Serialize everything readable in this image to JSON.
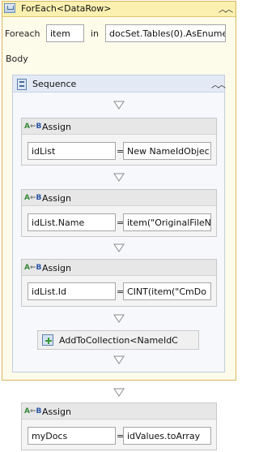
{
  "foreach": {
    "title": "ForEach<DataRow>",
    "foreach_label": "Foreach",
    "item_value": "item",
    "in_label": "in",
    "collection_value": "docSet.Tables(0).AsEnume",
    "body_label": "Body",
    "collapse_icon": "double-chevron-up"
  },
  "sequence": {
    "title": "Sequence",
    "collapse_icon": "double-chevron-up",
    "activities": [
      {
        "title": "Assign",
        "to": "idList",
        "eq": "=",
        "value": "New NameIdObjec"
      },
      {
        "title": "Assign",
        "to": "idList.Name",
        "eq": "=",
        "value": "item(\"OriginalFileN"
      },
      {
        "title": "Assign",
        "to": "idList.Id",
        "eq": "=",
        "value": "CINT(item(\"CmDo"
      }
    ],
    "add_to_collection": {
      "title": "AddToCollection<NameIdC"
    }
  },
  "outer_assign": {
    "title": "Assign",
    "to": "myDocs",
    "eq": "=",
    "value": "idValues.toArray"
  },
  "icons": {
    "assign": "assign-ab-icon",
    "arrow": "down-arrow-icon"
  },
  "colors": {
    "foreach_header": "#fbf0b0",
    "foreach_border": "#d8b760",
    "sequence_header": "#e3eaf5"
  }
}
